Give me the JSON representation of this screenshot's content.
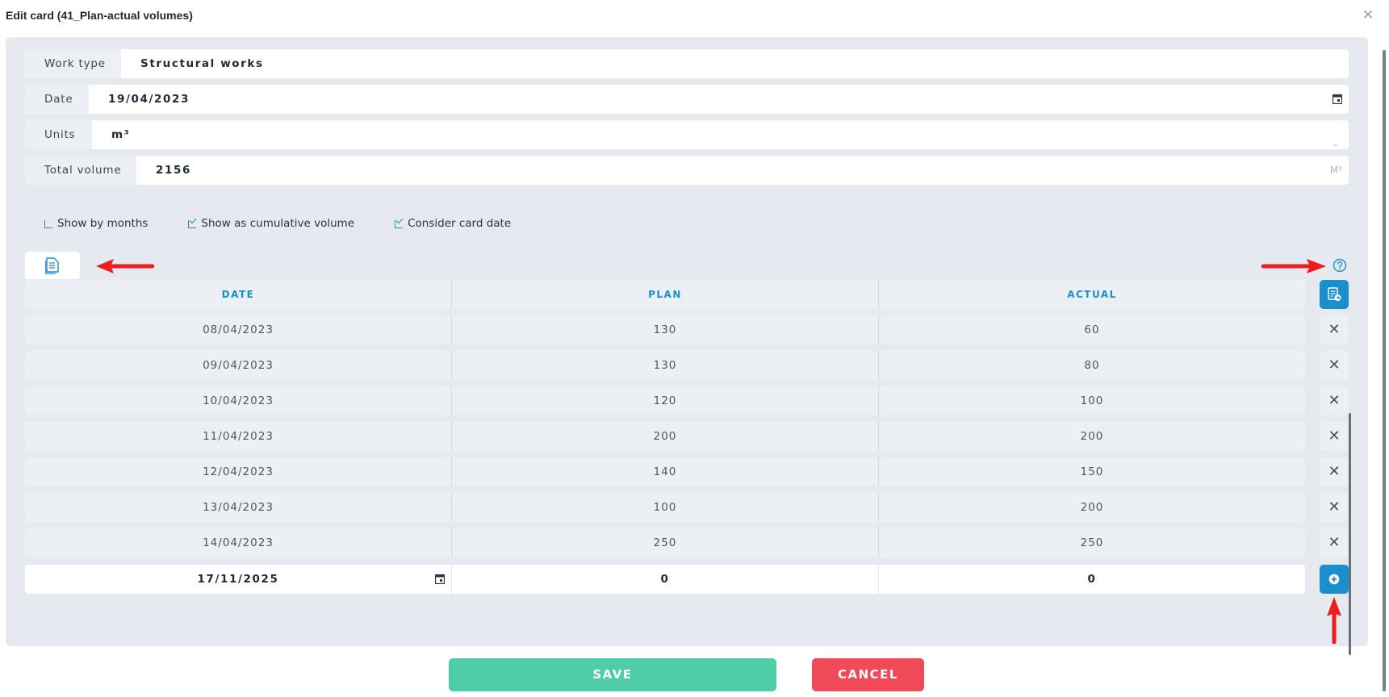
{
  "dialog": {
    "title": "Edit card (41_Plan-actual volumes)"
  },
  "fields": {
    "work_type": {
      "label": "Work type",
      "value": "Structural works"
    },
    "date": {
      "label": "Date",
      "value": "19/04/2023"
    },
    "units": {
      "label": "Units",
      "value": "m³"
    },
    "total_volume": {
      "label": "Total volume",
      "value": "2156",
      "suffix": "M³"
    }
  },
  "options": {
    "show_by_months": {
      "label": "Show by months",
      "checked": false
    },
    "show_cumulative": {
      "label": "Show as cumulative volume",
      "checked": true
    },
    "consider_card_date": {
      "label": "Consider card date",
      "checked": true
    }
  },
  "table": {
    "headers": [
      "DATE",
      "PLAN",
      "ACTUAL"
    ],
    "rows": [
      {
        "date": "08/04/2023",
        "plan": "130",
        "actual": "60"
      },
      {
        "date": "09/04/2023",
        "plan": "130",
        "actual": "80"
      },
      {
        "date": "10/04/2023",
        "plan": "120",
        "actual": "100"
      },
      {
        "date": "11/04/2023",
        "plan": "200",
        "actual": "200"
      },
      {
        "date": "12/04/2023",
        "plan": "140",
        "actual": "150"
      },
      {
        "date": "13/04/2023",
        "plan": "100",
        "actual": "200"
      },
      {
        "date": "14/04/2023",
        "plan": "250",
        "actual": "250"
      }
    ],
    "new_row": {
      "date": "17/11/2025",
      "plan": "0",
      "actual": "0"
    }
  },
  "buttons": {
    "save": "SAVE",
    "cancel": "CANCEL"
  },
  "colors": {
    "accent": "#1a8fd0",
    "save": "#4ecda6",
    "cancel": "#f04a59",
    "annotation": "#ee1c1c"
  },
  "icons": [
    "close-icon",
    "calendar-icon",
    "chevron-down-icon",
    "document-icon",
    "help-icon",
    "export-icon",
    "delete-icon",
    "add-icon",
    "red-arrow-annotation"
  ]
}
